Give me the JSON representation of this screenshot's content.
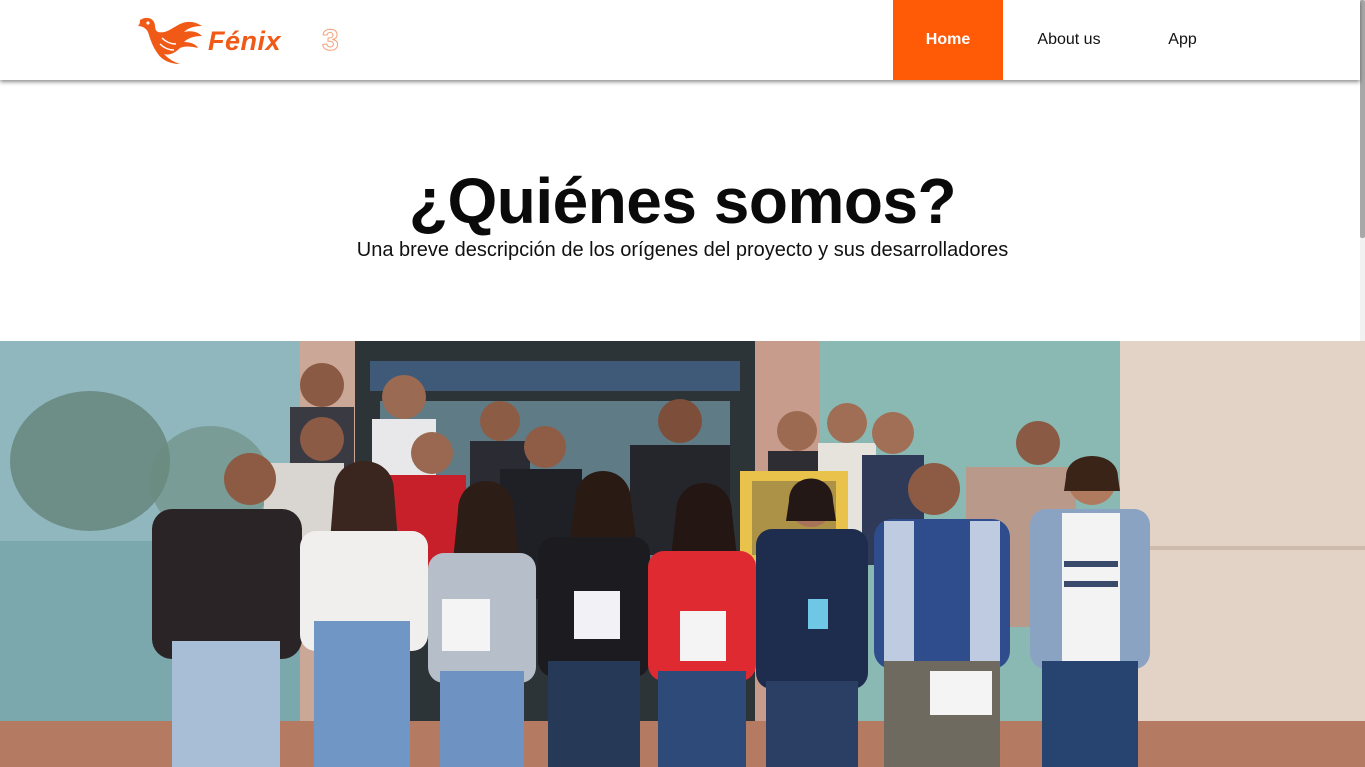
{
  "header": {
    "logo": {
      "icon": "phoenix-icon",
      "text": "Fénix",
      "number": "3",
      "color": "#f05a16"
    },
    "nav": {
      "home": "Home",
      "about": "About us",
      "app": "App",
      "active_color": "#ff5a05"
    }
  },
  "hero": {
    "title": "¿Quiénes somos?",
    "subtitle": "Una breve descripción de los orígenes del proyecto y sus desarrolladores"
  },
  "team_photo": {
    "icon": "team-group-photo"
  }
}
